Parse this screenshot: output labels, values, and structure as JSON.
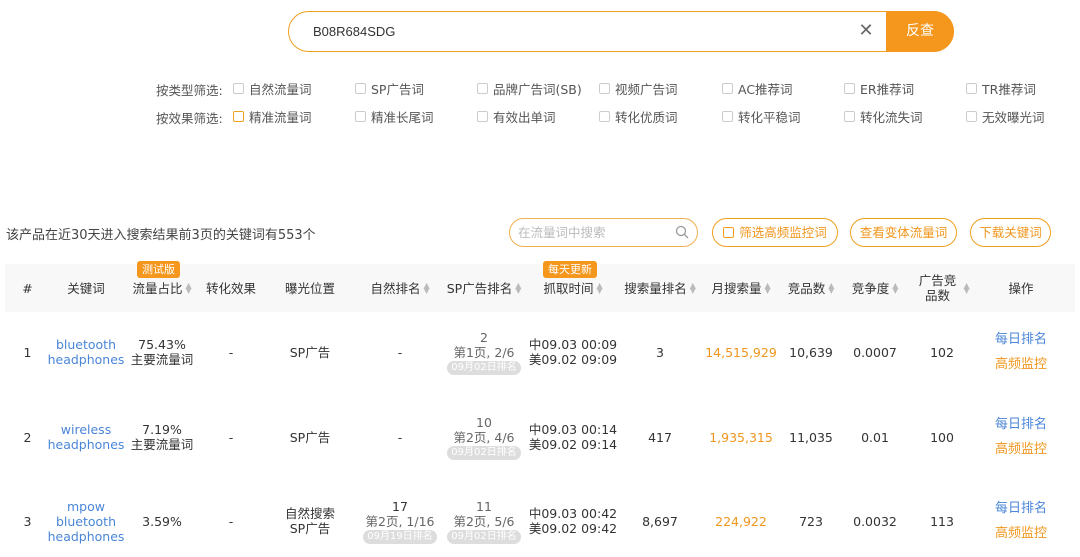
{
  "search": {
    "value": "B08R684SDG",
    "clear_icon": "close-icon",
    "button_label": "反查"
  },
  "filters": {
    "type": {
      "label": "按类型筛选:",
      "options": [
        "自然流量词",
        "SP广告词",
        "品牌广告词(SB)",
        "视频广告词",
        "AC推荐词",
        "ER推荐词",
        "TR推荐词"
      ]
    },
    "effect": {
      "label": "按效果筛选:",
      "options": [
        "精准流量词",
        "精准长尾词",
        "有效出单词",
        "转化优质词",
        "转化平稳词",
        "转化流失词",
        "无效曝光词"
      ]
    }
  },
  "summary": {
    "text": "该产品在近30天进入搜索结果前3页的关键词有553个",
    "keyword_search_placeholder": "在流量词中搜索",
    "filter_high_freq": "筛选高频监控词",
    "view_variant": "查看变体流量词",
    "download": "下载关键词"
  },
  "table": {
    "headers": {
      "index": "#",
      "keyword": "关键词",
      "traffic_share": "流量占比",
      "traffic_tag": "测试版",
      "conversion": "转化效果",
      "exposure": "曝光位置",
      "organic_rank": "自然排名",
      "sp_rank": "SP广告排名",
      "sp_tag": "每天更新",
      "fetch_time": "抓取时间",
      "search_rank": "搜索量排名",
      "monthly_search": "月搜索量",
      "competitors": "竞品数",
      "competition": "竞争度",
      "ad_competitors": "广告竞品数",
      "actions": "操作"
    },
    "rows": [
      {
        "index": "1",
        "keyword_line1": "bluetooth",
        "keyword_line2": "headphones",
        "keyword_line3": "",
        "share": "75.43%",
        "share_note": "主要流量词",
        "conversion": "-",
        "exposure_line1": "SP广告",
        "exposure_line2": "",
        "organic_main": "-",
        "organic_sub": "",
        "organic_tag": "",
        "sp_main": "2",
        "sp_sub": "第1页, 2/6",
        "sp_tag": "09月02日排名",
        "time_cn": "中09.03 00:09",
        "time_us": "美09.02 09:09",
        "search_rank": "3",
        "monthly": "14,515,929",
        "competitors": "10,639",
        "competition": "0.0007",
        "ad_competitors": "102",
        "action1": "每日排名",
        "action2": "高频监控"
      },
      {
        "index": "2",
        "keyword_line1": "wireless",
        "keyword_line2": "headphones",
        "keyword_line3": "",
        "share": "7.19%",
        "share_note": "主要流量词",
        "conversion": "-",
        "exposure_line1": "SP广告",
        "exposure_line2": "",
        "organic_main": "-",
        "organic_sub": "",
        "organic_tag": "",
        "sp_main": "10",
        "sp_sub": "第2页, 4/6",
        "sp_tag": "09月02日排名",
        "time_cn": "中09.03 00:14",
        "time_us": "美09.02 09:14",
        "search_rank": "417",
        "monthly": "1,935,315",
        "competitors": "11,035",
        "competition": "0.01",
        "ad_competitors": "100",
        "action1": "每日排名",
        "action2": "高频监控"
      },
      {
        "index": "3",
        "keyword_line1": "mpow",
        "keyword_line2": "bluetooth",
        "keyword_line3": "headphones",
        "share": "3.59%",
        "share_note": "",
        "conversion": "-",
        "exposure_line1": "自然搜索",
        "exposure_line2": "SP广告",
        "organic_main": "17",
        "organic_sub": "第2页, 1/16",
        "organic_tag": "09月19日排名",
        "sp_main": "11",
        "sp_sub": "第2页, 5/6",
        "sp_tag": "09月02日排名",
        "time_cn": "中09.03 00:42",
        "time_us": "美09.02 09:42",
        "search_rank": "8,697",
        "monthly": "224,922",
        "competitors": "723",
        "competition": "0.0032",
        "ad_competitors": "113",
        "action1": "每日排名",
        "action2": "高频监控"
      }
    ]
  },
  "colors": {
    "accent": "#f5961d",
    "link": "#4a86d8"
  }
}
